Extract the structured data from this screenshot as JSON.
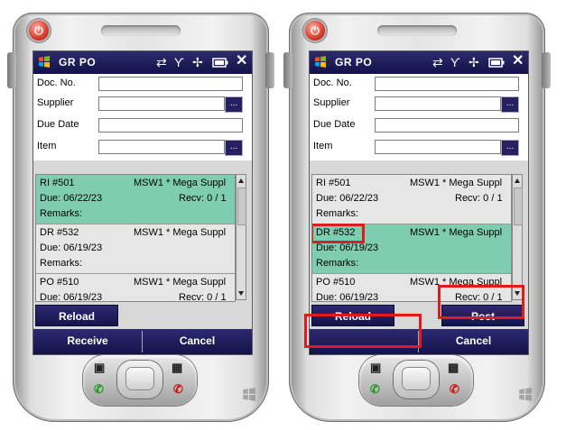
{
  "phones": [
    {
      "title": "GR PO",
      "fields": [
        {
          "label": "Doc. No.",
          "value": ""
        },
        {
          "label": "Supplier",
          "value": ""
        },
        {
          "label": "Due Date",
          "value": ""
        },
        {
          "label": "Item",
          "value": ""
        }
      ],
      "lookup_label": "...",
      "items": [
        {
          "doc": "RI #501",
          "supplier": "MSW1 * Mega Suppl",
          "due": "Due: 06/22/23",
          "recv": "Recv: 0 / 1",
          "remarks": "Remarks:"
        },
        {
          "doc": "DR #532",
          "supplier": "MSW1 * Mega Suppl",
          "due": "Due: 06/19/23",
          "recv": "",
          "remarks": "Remarks:"
        },
        {
          "doc": "PO #510",
          "supplier": "MSW1 * Mega Suppl",
          "due": "Due: 06/19/23",
          "recv": "Recv: 0 / 1",
          "remarks": ""
        }
      ],
      "selected_index": 0,
      "reload_label": "Reload",
      "post_label": "",
      "soft_left": "Receive",
      "soft_right": "Cancel"
    },
    {
      "title": "GR PO",
      "fields": [
        {
          "label": "Doc. No.",
          "value": ""
        },
        {
          "label": "Supplier",
          "value": ""
        },
        {
          "label": "Due Date",
          "value": ""
        },
        {
          "label": "Item",
          "value": ""
        }
      ],
      "lookup_label": "...",
      "items": [
        {
          "doc": "RI #501",
          "supplier": "MSW1 * Mega Suppl",
          "due": "Due: 06/22/23",
          "recv": "Recv: 0 / 1",
          "remarks": "Remarks:"
        },
        {
          "doc": "DR #532",
          "supplier": "MSW1 * Mega Suppl",
          "due": "Due: 06/19/23",
          "recv": "",
          "remarks": "Remarks:"
        },
        {
          "doc": "PO #510",
          "supplier": "MSW1 * Mega Suppl",
          "due": "Due: 06/19/23",
          "recv": "Recv: 0 / 1",
          "remarks": ""
        }
      ],
      "selected_index": 1,
      "reload_label": "Reload",
      "post_label": "Post",
      "soft_left": "",
      "soft_right": "Cancel"
    }
  ],
  "colors": {
    "titlebar": "#1c1a5a",
    "selected_row": "#7ecdb0",
    "highlight": "#e11b1b"
  },
  "icons": [
    "windows-logo-icon",
    "sync-icon",
    "no-signal-icon",
    "speaker-muted-icon",
    "battery-icon",
    "close-icon",
    "power-icon",
    "calendar-key-icon",
    "grid-key-icon",
    "call-icon",
    "end-call-icon"
  ]
}
